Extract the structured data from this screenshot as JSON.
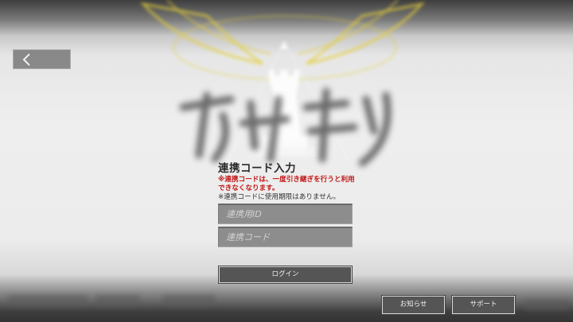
{
  "login": {
    "title": "連携コード入力",
    "warning": "※連携コードは、一度引き継ぎを行うと利用できなくなります。",
    "note": "※連携コードに使用期限はありません。",
    "id_placeholder": "連携用ID",
    "code_placeholder": "連携コード",
    "login_label": "ログイン"
  },
  "footer": {
    "news_label": "お知らせ",
    "support_label": "サポート"
  },
  "icons": {
    "back": "chevron-left-icon"
  },
  "colors": {
    "warning_red": "#c11515",
    "button_bg": "#555555",
    "field_bg": "#8d8d8d",
    "emblem_gold": "#e6cf3a"
  }
}
